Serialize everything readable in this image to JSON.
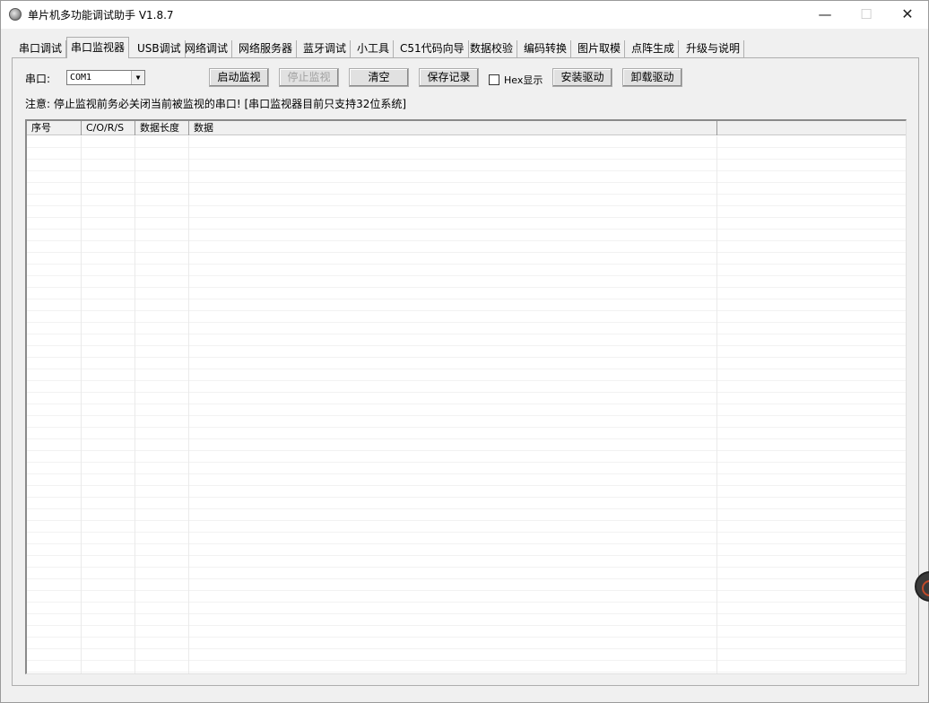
{
  "window": {
    "title": "单片机多功能调试助手 V1.8.7",
    "minimize_glyph": "—",
    "maximize_glyph": "☐",
    "close_glyph": "✕",
    "icon": "app-gear-icon"
  },
  "tabs": [
    {
      "label": "串口调试"
    },
    {
      "label": "串口监视器"
    },
    {
      "label": "USB调试"
    },
    {
      "label": "网络调试"
    },
    {
      "label": "网络服务器"
    },
    {
      "label": "蓝牙调试"
    },
    {
      "label": "小工具"
    },
    {
      "label": "C51代码向导"
    },
    {
      "label": "数据校验"
    },
    {
      "label": "编码转换"
    },
    {
      "label": "图片取模"
    },
    {
      "label": "点阵生成"
    },
    {
      "label": "升级与说明"
    }
  ],
  "active_tab": "串口监视器",
  "monitor": {
    "port_label": "串口:",
    "port_value": "COM1",
    "buttons": {
      "start": "启动监视",
      "stop": "停止监视",
      "clear": "清空",
      "save": "保存记录",
      "install": "安装驱动",
      "uninstall": "卸载驱动"
    },
    "hex_checkbox_label": "Hex显示",
    "hex_checked": false,
    "notice": "注意: 停止监视前务必关闭当前被监视的串口! [串口监视器目前只支持32位系统]",
    "columns": [
      "序号",
      "C/O/R/S",
      "数据长度",
      "数据",
      ""
    ],
    "rows": []
  }
}
